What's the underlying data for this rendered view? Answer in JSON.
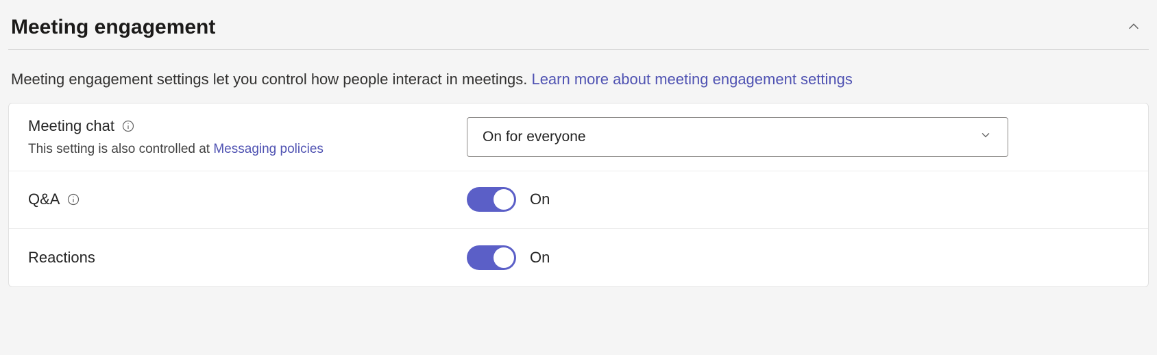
{
  "section": {
    "title": "Meeting engagement",
    "description_prefix": "Meeting engagement settings let you control how people interact in meetings. ",
    "description_link": "Learn more about meeting engagement settings"
  },
  "settings": {
    "meeting_chat": {
      "label": "Meeting chat",
      "subtext_prefix": "This setting is also controlled at ",
      "subtext_link": "Messaging policies",
      "value": "On for everyone"
    },
    "qa": {
      "label": "Q&A",
      "state": "On"
    },
    "reactions": {
      "label": "Reactions",
      "state": "On"
    }
  }
}
